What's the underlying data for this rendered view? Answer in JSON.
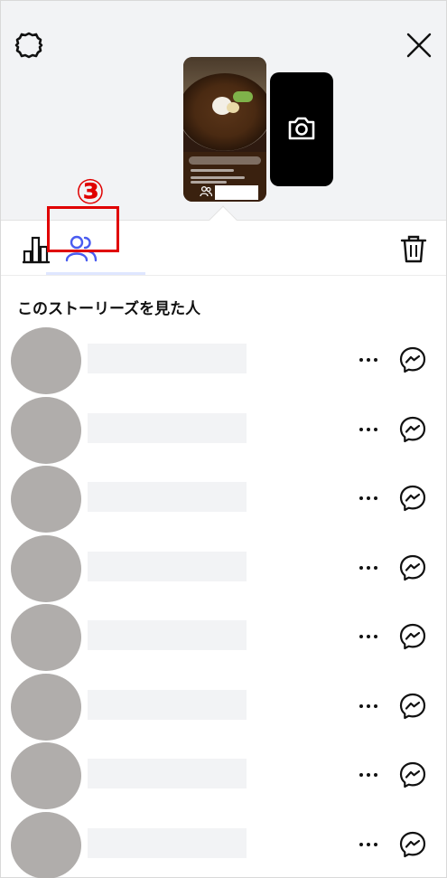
{
  "header": {
    "settings_icon": "gear-icon",
    "close_icon": "close-icon"
  },
  "preview": {
    "story_thumbnail": "ramen-story-thumbnail",
    "camera_icon": "camera-icon"
  },
  "annotation": {
    "step_label": "③",
    "color": "#e00000"
  },
  "tabs": {
    "insights_icon": "bar-chart-icon",
    "viewers_icon": "people-icon",
    "delete_icon": "trash-icon",
    "active_color": "#4a5cf0"
  },
  "viewers": {
    "title": "このストーリーズを見た人",
    "rows": [
      {
        "more_icon": "more-icon",
        "message_icon": "messenger-icon"
      },
      {
        "more_icon": "more-icon",
        "message_icon": "messenger-icon"
      },
      {
        "more_icon": "more-icon",
        "message_icon": "messenger-icon"
      },
      {
        "more_icon": "more-icon",
        "message_icon": "messenger-icon"
      },
      {
        "more_icon": "more-icon",
        "message_icon": "messenger-icon"
      },
      {
        "more_icon": "more-icon",
        "message_icon": "messenger-icon"
      },
      {
        "more_icon": "more-icon",
        "message_icon": "messenger-icon"
      },
      {
        "more_icon": "more-icon",
        "message_icon": "messenger-icon"
      }
    ]
  }
}
